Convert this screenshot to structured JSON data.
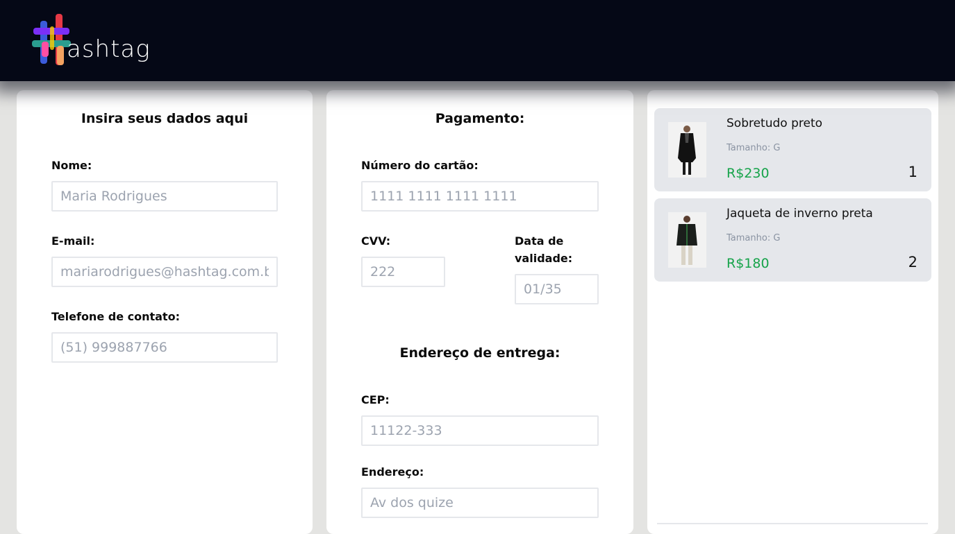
{
  "brand": {
    "logo_text": "ashtag",
    "logo_colors": [
      "#3b5bdb",
      "#7b2ff7",
      "#e63946",
      "#f4a261",
      "#2a9d8f",
      "#ff4fa3"
    ]
  },
  "dados": {
    "title": "Insira seus dados aqui",
    "nome_label": "Nome:",
    "nome_placeholder": "Maria Rodrigues",
    "email_label": "E-mail:",
    "email_placeholder": "mariarodrigues@hashtag.com.br",
    "telefone_label": "Telefone de contato:",
    "telefone_placeholder": "(51) 999887766"
  },
  "pagamento": {
    "title": "Pagamento:",
    "cartao_label": "Número do cartão:",
    "cartao_placeholder": "1111 1111 1111 1111",
    "cvv_label": "CVV:",
    "cvv_placeholder": "222",
    "validade_label_line1": "Data de",
    "validade_label_line2": "validade:",
    "validade_placeholder": "01/35"
  },
  "entrega": {
    "title": "Endereço de entrega:",
    "cep_label": "CEP:",
    "cep_placeholder": "11122-333",
    "endereco_label": "Endereço:",
    "endereco_placeholder": "Av dos quize"
  },
  "carrinho": {
    "items": [
      {
        "name": "Sobretudo preto",
        "size": "Tamanho: G",
        "price": "R$230",
        "qty": "1",
        "icon": "coat-product-image"
      },
      {
        "name": "Jaqueta de inverno preta",
        "size": "Tamanho: G",
        "price": "R$180",
        "qty": "2",
        "icon": "jacket-product-image"
      }
    ]
  },
  "colors": {
    "header_bg": "#050816",
    "price": "#16a34a",
    "card_bg": "#ffffff",
    "page_bg": "#e4e4e2",
    "item_bg": "#e5e7eb"
  }
}
